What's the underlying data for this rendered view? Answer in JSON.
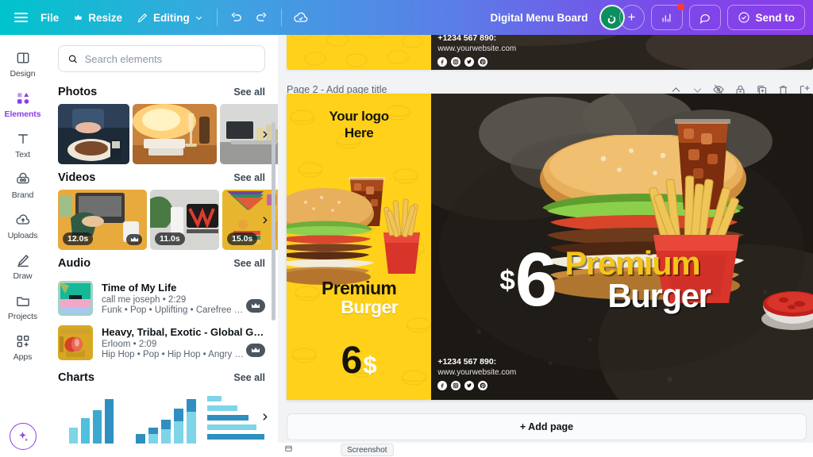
{
  "topbar": {
    "menu_icon": "hamburger-icon",
    "file_label": "File",
    "resize_label": "Resize",
    "resize_icon": "crown-icon",
    "editing_label": "Editing",
    "editing_icon": "pencil-icon",
    "editing_caret": "chevron-down-icon",
    "undo_icon": "undo-icon",
    "redo_icon": "redo-icon",
    "cloud_icon": "cloud-check-icon",
    "doc_title": "Digital Menu Board",
    "avatar_initial": "ن",
    "add_collaborator_icon": "plus-icon",
    "insights_icon": "bar-chart-icon",
    "comments_icon": "comment-bubble-icon",
    "send_label": "Send to",
    "send_icon": "check-circle-icon"
  },
  "rail": {
    "items": [
      {
        "label": "Design",
        "icon": "layout-icon",
        "active": false
      },
      {
        "label": "Elements",
        "icon": "shapes-icon",
        "active": true
      },
      {
        "label": "Text",
        "icon": "text-t-icon",
        "active": false
      },
      {
        "label": "Brand",
        "icon": "brand-icon",
        "active": false
      },
      {
        "label": "Uploads",
        "icon": "upload-cloud-icon",
        "active": false
      },
      {
        "label": "Draw",
        "icon": "pen-draw-icon",
        "active": false
      },
      {
        "label": "Projects",
        "icon": "folder-icon",
        "active": false
      },
      {
        "label": "Apps",
        "icon": "apps-grid-icon",
        "active": false
      }
    ],
    "magic_icon": "sparkle-icon"
  },
  "panel": {
    "search": {
      "placeholder": "Search elements",
      "value": "",
      "icon": "search-icon"
    },
    "see_all_label": "See all",
    "sections": [
      {
        "title": "Photos",
        "next_icon": "chevron-right-icon"
      },
      {
        "title": "Videos",
        "next_icon": "chevron-right-icon"
      },
      {
        "title": "Audio",
        "next_icon": "chevron-right-icon"
      },
      {
        "title": "Charts",
        "next_icon": "chevron-right-icon"
      }
    ],
    "videos": [
      {
        "duration": "12.0s",
        "badge": "pro-badge"
      },
      {
        "duration": "11.0s",
        "badge": ""
      },
      {
        "duration": "15.0s",
        "badge": ""
      }
    ],
    "audio": [
      {
        "title": "Time of My Life",
        "artist_duration": "call me joseph • 2:29",
        "tags": "Funk • Pop • Uplifting • Carefree •…",
        "badge": "pro-badge"
      },
      {
        "title": "Heavy, Tribal, Exotic - Global Gan…",
        "artist_duration": "Erloom • 2:09",
        "tags": "Hip Hop • Pop • Hip Hop • Angry •…",
        "badge": "pro-badge"
      }
    ]
  },
  "canvas": {
    "page_label": "Page 2 - ",
    "page_title_placeholder": "Add page title",
    "tools": [
      {
        "name": "move-up-icon",
        "glyph": "up"
      },
      {
        "name": "move-down-icon",
        "glyph": "down"
      },
      {
        "name": "hide-page-icon",
        "glyph": "eyeslash"
      },
      {
        "name": "lock-page-icon",
        "glyph": "lock"
      },
      {
        "name": "duplicate-page-icon",
        "glyph": "dup"
      },
      {
        "name": "delete-page-icon",
        "glyph": "trash"
      },
      {
        "name": "expand-page-icon",
        "glyph": "expand"
      }
    ],
    "add_page_label": "+ Add page",
    "screenshot_chip": "Screenshot"
  },
  "design": {
    "logo_line1": "Your logo",
    "logo_line2": "Here",
    "left_premium": "Premium",
    "left_burger": "Burger",
    "left_price_number": "6",
    "left_price_currency": "$",
    "right_price_currency": "$",
    "right_price_number": "6",
    "right_premium": "Premium",
    "right_burger": "Burger",
    "phone": "+1234 567 890:",
    "website": "www.yourwebsite.com",
    "socials": [
      "facebook-icon",
      "instagram-icon",
      "twitter-icon",
      "pinterest-icon"
    ]
  },
  "colors": {
    "brand_start": "#00c4cc",
    "brand_end": "#8b3dea",
    "accent_purple": "#8b3dea",
    "poster_yellow": "#ffd11a",
    "poster_gold": "#f5c518",
    "avatar_green": "#0c8f5f",
    "notification_red": "#ff3b30"
  }
}
